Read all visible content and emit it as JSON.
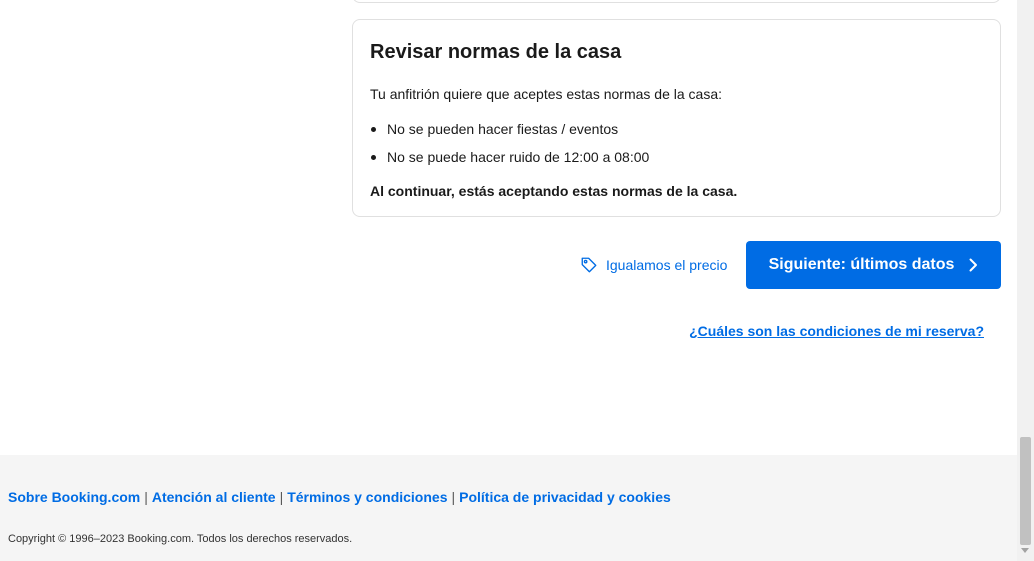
{
  "rules": {
    "title": "Revisar normas de la casa",
    "intro": "Tu anfitrión quiere que aceptes estas normas de la casa:",
    "items": [
      "No se pueden hacer fiestas / eventos",
      "No se puede hacer ruido de 12:00 a 08:00"
    ],
    "accept_note": "Al continuar, estás aceptando estas normas de la casa."
  },
  "actions": {
    "price_match_label": "Igualamos el precio",
    "price_match_icon": "tag-icon",
    "next_button_label": "Siguiente: últimos datos",
    "next_button_icon": "chevron-right-icon",
    "conditions_link": "¿Cuáles son las condiciones de mi reserva?"
  },
  "footer": {
    "links": [
      "Sobre Booking.com",
      "Atención al cliente",
      "Términos y condiciones",
      "Política de privacidad y cookies"
    ],
    "separator": "|",
    "copyright": "Copyright © 1996–2023 Booking.com. Todos los derechos reservados."
  },
  "colors": {
    "primary": "#006ce4",
    "text": "#1a1a1a",
    "footer_bg": "#f5f5f5",
    "border": "#e0e0e0"
  }
}
